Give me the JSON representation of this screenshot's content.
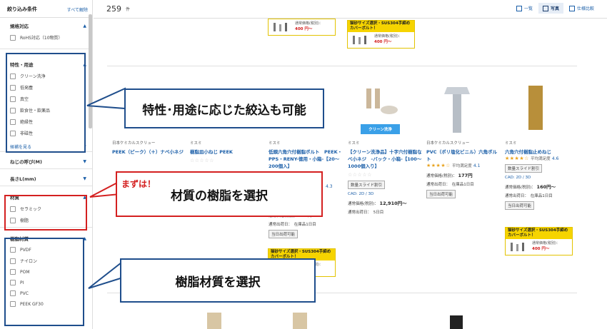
{
  "sidebar": {
    "title": "絞り込み条件",
    "clear_all": "すべて解除",
    "sections": [
      {
        "title": "規格対応",
        "options": [
          "RoHS対応（10物質）"
        ]
      },
      {
        "title": "特性・用途",
        "options": [
          "クリーン洗浄",
          "低発塵",
          "真空",
          "飲食住・飲薬品",
          "絶縁性",
          "非磁性"
        ],
        "more": "候補を見る"
      },
      {
        "title": "ねじの呼び(M)"
      },
      {
        "title": "長さL(mm)"
      },
      {
        "title": "材質",
        "options": [
          "セラミック",
          "樹脂"
        ]
      },
      {
        "title": "樹脂材質",
        "options": [
          "PVDF",
          "ナイロン",
          "POM",
          "PI",
          "PVC",
          "PEEK GF30"
        ]
      }
    ]
  },
  "results": {
    "count": "259",
    "unit": "件"
  },
  "views": [
    {
      "label": "一覧",
      "icon": "list-view-icon"
    },
    {
      "label": "写真",
      "icon": "photo-view-icon",
      "active": true
    },
    {
      "label": "仕様比較",
      "icon": "compare-view-icon"
    }
  ],
  "promo": {
    "head": "猫砂サイズ選択・SUS304手締め カバーボルト！",
    "price_label": "通常価格(税別)：",
    "price": "400 円〜"
  },
  "products": [
    {
      "maker": "日本ケミカルスクリュー",
      "name": "PEEK（ピーク）（＋）ナベ小ネジ"
    },
    {
      "maker": "ミスミ",
      "name": "樹脂皿小ねじ PEEK",
      "stars_empty": "☆☆☆☆☆"
    },
    {
      "maker": "ミスミ",
      "name": "低頭六角穴付樹脂ボルト　PEEK・PPS・RENY-徳用・小箱-【20〜200個入】",
      "rate_tail": "4.3",
      "price": "通常価格(税別)： 640円〜",
      "ship": "通常出荷日：　在庫品1日目",
      "tag": "当日出荷可能"
    },
    {
      "maker": "ミスミ",
      "name": "【クリーン洗浄品】十字穴付樹脂なべ小ネジ　-バック・小箱-【100〜1000個入り】",
      "stars_empty": "☆☆☆☆☆",
      "tag1": "数量スライド割引",
      "cad": "CAD: 2D / 3D",
      "price_label": "通常価格(税別)：",
      "price": "12,910円〜",
      "ship": "通常出荷日：　5日目",
      "badge": "クリーン洗浄"
    },
    {
      "maker": "日本ケミカルスクリュー",
      "name": "PVC（ポリ塩化ビニル）六角ボルト",
      "stars": "★★★★☆",
      "rate_label": "平均満足度",
      "rate": "4.1",
      "price_label": "通常価格(税別)：",
      "price": "177円",
      "ship": "通常出荷日：　在庫品1日目",
      "tag": "当日出荷可能"
    },
    {
      "maker": "ミスミ",
      "name": "六角穴付樹脂止めねじ",
      "stars": "★★★★☆",
      "rate_label": "平均満足度",
      "rate": "4.6",
      "tag1": "数量スライド割引",
      "cad": "CAD: 2D / 3D",
      "price_label": "通常価格(税別)：",
      "price": "160円〜",
      "ship": "通常出荷日：　在庫品1日目",
      "tag": "当日出荷可能"
    }
  ],
  "callouts": {
    "c1": "特性･用途に応じた絞込も可能",
    "c2_lead": "まずは！",
    "c2": "材質の樹脂を選択",
    "c3": "樹脂材質を選択"
  }
}
